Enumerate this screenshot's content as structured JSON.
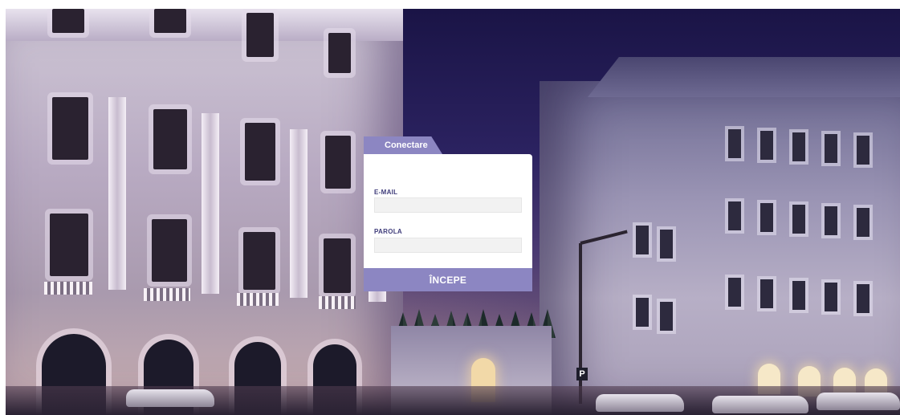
{
  "login": {
    "tab_label": "Conectare",
    "email_label": "E-MAIL",
    "email_value": "",
    "password_label": "PAROLA",
    "password_value": "",
    "submit_label": "ÎNCEPE"
  },
  "background": {
    "parking_sign": "P"
  },
  "colors": {
    "accent": "#8c86c2",
    "label": "#3f3c7a",
    "input_bg": "#f2f2f2"
  }
}
